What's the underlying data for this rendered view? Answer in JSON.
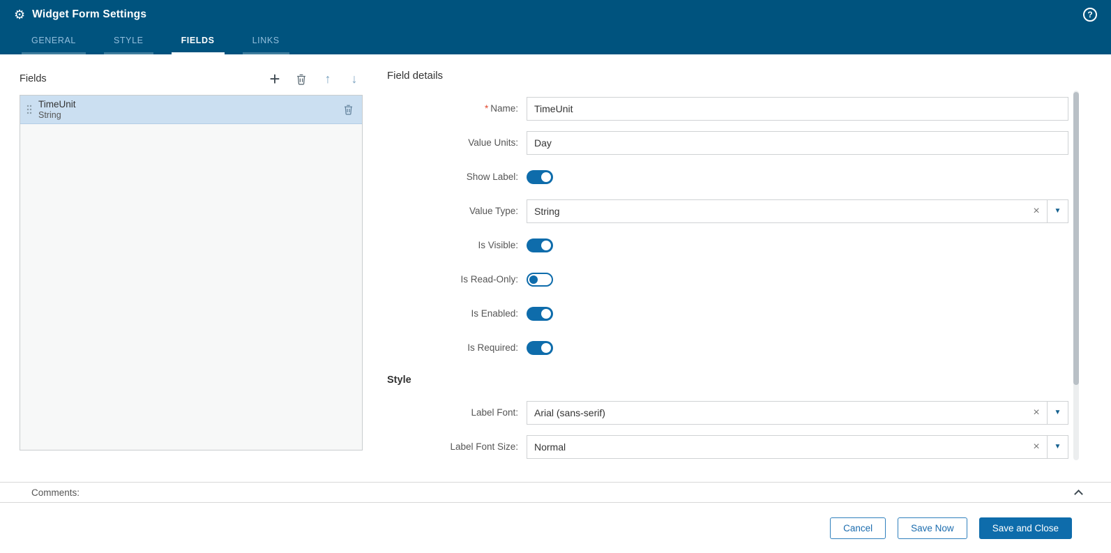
{
  "colors": {
    "header_bg": "#00537E",
    "accent": "#0E6CAB",
    "selected_row_bg": "#CBDFF1",
    "required_marker_color": "#E2492F"
  },
  "icons": {
    "gear": "⚙",
    "help": "?",
    "plus": "+",
    "arrow_up": "↑",
    "arrow_down": "↓",
    "clear": "×",
    "caret_down": "▼"
  },
  "header": {
    "title": "Widget Form Settings",
    "active_tab": "FIELDS",
    "tabs": [
      {
        "label": "GENERAL"
      },
      {
        "label": "STYLE"
      },
      {
        "label": "FIELDS"
      },
      {
        "label": "LINKS"
      }
    ]
  },
  "fields_panel": {
    "title": "Fields",
    "items": [
      {
        "name": "TimeUnit",
        "type": "String",
        "selected": true
      }
    ]
  },
  "details_panel": {
    "title": "Field details",
    "style_heading": "Style",
    "required_marker": "*",
    "rows": [
      {
        "label": "Name:",
        "type": "text",
        "required": true,
        "value": "TimeUnit"
      },
      {
        "label": "Value Units:",
        "type": "text",
        "value": "Day"
      },
      {
        "label": "Show Label:",
        "type": "toggle",
        "value": true
      },
      {
        "label": "Value Type:",
        "type": "combo",
        "value": "String"
      },
      {
        "label": "Is Visible:",
        "type": "toggle",
        "value": true
      },
      {
        "label": "Is Read-Only:",
        "type": "toggle",
        "value": false
      },
      {
        "label": "Is Enabled:",
        "type": "toggle",
        "value": true
      },
      {
        "label": "Is Required:",
        "type": "toggle",
        "value": true
      },
      {
        "label": "Label Font:",
        "type": "combo",
        "value": "Arial (sans-serif)"
      },
      {
        "label": "Label Font Size:",
        "type": "combo",
        "value": "Normal"
      }
    ]
  },
  "comments": {
    "label": "Comments:"
  },
  "footer": {
    "buttons": [
      {
        "label": "Cancel",
        "style": "outline"
      },
      {
        "label": "Save Now",
        "style": "outline"
      },
      {
        "label": "Save and Close",
        "style": "primary"
      }
    ]
  }
}
